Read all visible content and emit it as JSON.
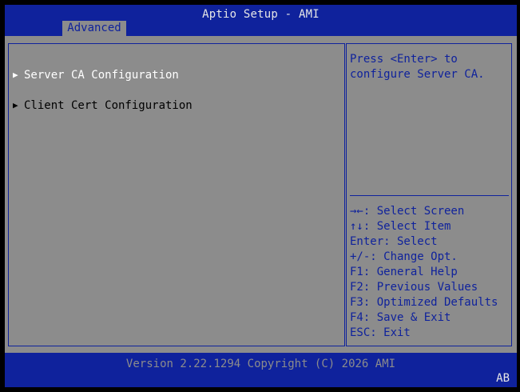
{
  "header": {
    "title": "Aptio Setup - AMI",
    "tabs": [
      {
        "label": "Advanced",
        "active": true
      }
    ]
  },
  "menu": {
    "items": [
      {
        "arrow": "▶",
        "label": "Server CA Configuration",
        "selected": true
      },
      {
        "arrow": "▶",
        "label": "Client Cert Configuration",
        "selected": false
      }
    ]
  },
  "help": {
    "text": "Press <Enter> to\nconfigure Server CA."
  },
  "keys": [
    "→←: Select Screen",
    "↑↓: Select Item",
    "Enter: Select",
    "+/-: Change Opt.",
    "F1: General Help",
    "F2: Previous Values",
    "F3: Optimized Defaults",
    "F4: Save & Exit",
    "ESC: Exit"
  ],
  "footer": {
    "version": "Version 2.22.1294 Copyright (C) 2026 AMI",
    "corner": "AB"
  },
  "colors": {
    "bar_blue": "#0f229c",
    "panel_gray": "#8c8c8c",
    "selected_text": "#ffffff",
    "normal_text": "#000000"
  }
}
